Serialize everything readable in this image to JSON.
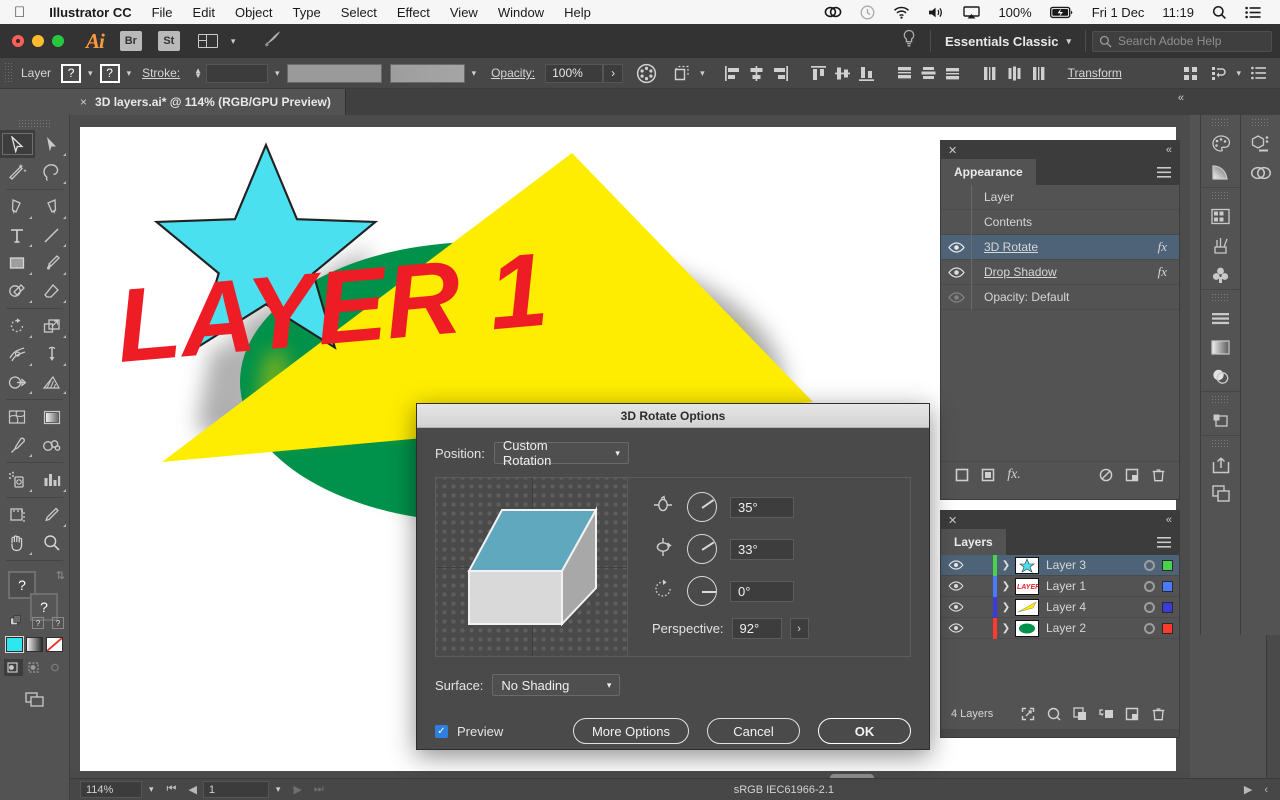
{
  "macmenu": {
    "apple": "apple-logo",
    "app": "Illustrator CC",
    "items": [
      "File",
      "Edit",
      "Object",
      "Type",
      "Select",
      "Effect",
      "View",
      "Window",
      "Help"
    ],
    "status": {
      "battery": "100%",
      "day": "Fri 1 Dec",
      "time": "11:19"
    }
  },
  "appbar": {
    "logo": "Ai",
    "bridge": "Br",
    "stock": "St",
    "workspace": "Essentials Classic",
    "search_placeholder": "Search Adobe Help"
  },
  "controlbar": {
    "label": "Layer",
    "fill_value": "?",
    "stroke_value": "?",
    "stroke_label": "Stroke:",
    "stroke_weight": "",
    "opacity_label": "Opacity:",
    "opacity_value": "100%",
    "transform_label": "Transform"
  },
  "tab": {
    "close": "×",
    "title": "3D layers.ai* @ 114% (RGB/GPU Preview)"
  },
  "artwork": {
    "text": "LAYER 1",
    "star_color": "#4ae0ef",
    "text_color": "#ee1c25",
    "triangle_color": "#ffed00",
    "ellipse_color": "#00914a"
  },
  "appearance": {
    "tab": "Appearance",
    "rows": [
      {
        "name": "Layer",
        "eye": false,
        "fx": "",
        "selected": false,
        "indent": true
      },
      {
        "name": "Contents",
        "eye": false,
        "fx": "",
        "selected": false,
        "indent": true
      },
      {
        "name": "3D Rotate",
        "eye": true,
        "fx": "fx",
        "selected": true,
        "indent": false
      },
      {
        "name": "Drop Shadow",
        "eye": true,
        "fx": "fx",
        "selected": false,
        "indent": false
      },
      {
        "name": "Opacity: Default",
        "eye": "dim",
        "fx": "",
        "selected": false,
        "indent": false
      }
    ],
    "footer_icons": [
      "add-new-stroke-icon",
      "add-new-fill-icon",
      "add-effect-icon",
      "clear-appearance-icon",
      "duplicate-item-icon",
      "delete-item-icon"
    ]
  },
  "layers": {
    "tab": "Layers",
    "rows": [
      {
        "name": "Layer 3",
        "color": "#4ad34a",
        "selected": true,
        "thumb": "star"
      },
      {
        "name": "Layer 1",
        "color": "#4a7aff",
        "selected": false,
        "thumb": "text"
      },
      {
        "name": "Layer 4",
        "color": "#3a3add",
        "selected": false,
        "thumb": "triangle"
      },
      {
        "name": "Layer 2",
        "color": "#ff3b30",
        "selected": false,
        "thumb": "ellipse"
      }
    ],
    "count_label": "4 Layers",
    "footer_icons": [
      "locate-object-icon",
      "make-clipping-mask-icon",
      "create-sublayer-icon",
      "release-to-layers-icon",
      "new-layer-icon",
      "delete-layer-icon"
    ]
  },
  "dialog": {
    "title": "3D Rotate Options",
    "position_label": "Position:",
    "position_value": "Custom Rotation",
    "rotations": [
      {
        "icon": "rotate-x-axis-icon",
        "value": "35°",
        "deg": 35
      },
      {
        "icon": "rotate-y-axis-icon",
        "value": "33°",
        "deg": 33
      },
      {
        "icon": "rotate-z-axis-icon",
        "value": "0°",
        "deg": 0
      }
    ],
    "perspective_label": "Perspective:",
    "perspective_value": "92°",
    "surface_label": "Surface:",
    "surface_value": "No Shading",
    "preview_label": "Preview",
    "preview_checked": true,
    "more_options": "More Options",
    "cancel": "Cancel",
    "ok": "OK",
    "cube_top_color": "#5fa8be",
    "cube_left_color": "#d9d9d9",
    "cube_right_color": "#a8a8a8"
  },
  "statusbar": {
    "zoom": "114%",
    "artboard": "1",
    "profile": "sRGB IEC61966-2.1"
  },
  "dock": {
    "col1": [
      "color-panel-icon",
      "gradient-panel-icon",
      "swatches-panel-icon",
      "brushes-panel-icon",
      "symbols-panel-icon",
      "align-panel-icon",
      "gradient-mesh-icon",
      "transparency-panel-icon",
      "pathfinder-panel-icon",
      "export-panel-icon",
      "artboards-panel-icon"
    ],
    "col2": [
      "libraries-panel-icon",
      "creative-cloud-icon"
    ]
  },
  "tools": {
    "items": [
      [
        "selection-tool",
        "direct-selection-tool"
      ],
      [
        "magic-wand-tool",
        "lasso-tool"
      ],
      [
        "pen-tool",
        "curvature-tool"
      ],
      [
        "type-tool",
        "line-segment-tool"
      ],
      [
        "rectangle-tool",
        "paintbrush-tool"
      ],
      [
        "shaper-tool",
        "eraser-tool"
      ],
      [
        "rotate-tool",
        "scale-tool"
      ],
      [
        "width-tool",
        "free-transform-tool"
      ],
      [
        "shape-builder-tool",
        "perspective-grid-tool"
      ],
      [
        "mesh-tool",
        "gradient-tool"
      ],
      [
        "eyedropper-tool",
        "blend-tool"
      ],
      [
        "symbol-sprayer-tool",
        "column-graph-tool"
      ],
      [
        "artboard-tool",
        "slice-tool"
      ],
      [
        "hand-tool",
        "zoom-tool"
      ]
    ],
    "fill_value": "?",
    "stroke_value": "?",
    "swatches": [
      "#2ee6ef",
      "gradient",
      "none"
    ],
    "modes": [
      "draw-normal-icon",
      "draw-behind-icon",
      "draw-inside-icon"
    ],
    "screen_mode": "change-screen-mode-icon"
  }
}
